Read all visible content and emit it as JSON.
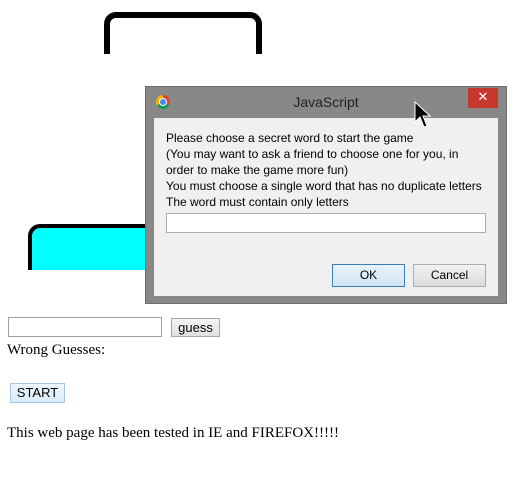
{
  "dialog": {
    "title": "JavaScript",
    "close_label": "✕",
    "message_lines": [
      "Please choose a secret word to start the game",
      "(You may want to ask a friend to choose one for you, in",
      "order to make the game more fun)",
      "You must choose a single word that has no duplicate letters",
      "The word must contain only letters"
    ],
    "input_value": "",
    "ok_label": "OK",
    "cancel_label": "Cancel"
  },
  "game": {
    "guess_value": "",
    "guess_label": "guess",
    "wrong_guesses_label": "Wrong Guesses:",
    "start_label": "START",
    "footer": "This web page has been tested in IE and FIREFOX!!!!!"
  },
  "colors": {
    "base_fill": "#00ffff",
    "dialog_frame": "#888888",
    "close_button": "#c7392f"
  }
}
